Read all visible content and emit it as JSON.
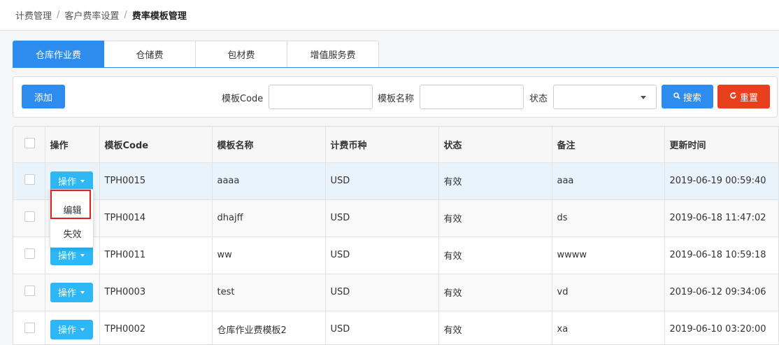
{
  "breadcrumb": [
    "计费管理",
    "客户费率设置",
    "费率模板管理"
  ],
  "tabs": [
    {
      "label": "仓库作业费",
      "active": true
    },
    {
      "label": "仓储费",
      "active": false
    },
    {
      "label": "包材费",
      "active": false
    },
    {
      "label": "增值服务费",
      "active": false
    }
  ],
  "filter": {
    "add_label": "添加",
    "code_label": "模板Code",
    "code_value": "",
    "name_label": "模板名称",
    "name_value": "",
    "status_label": "状态",
    "status_value": "",
    "search_label": "搜索",
    "reset_label": "重置"
  },
  "table": {
    "headers": [
      "操作",
      "模板Code",
      "模板名称",
      "计费币种",
      "状态",
      "备注",
      "更新时间"
    ],
    "op_label": "操作",
    "rows": [
      {
        "code": "TPH0015",
        "name": "aaaa",
        "currency": "USD",
        "status": "有效",
        "remark": "aaa",
        "updated": "2019-06-19 00:59:40"
      },
      {
        "code": "TPH0014",
        "name": "dhajff",
        "currency": "USD",
        "status": "有效",
        "remark": "ds",
        "updated": "2019-06-18 11:47:02"
      },
      {
        "code": "TPH0011",
        "name": "ww",
        "currency": "USD",
        "status": "有效",
        "remark": "wwww",
        "updated": "2019-06-18 10:59:18"
      },
      {
        "code": "TPH0003",
        "name": "test",
        "currency": "USD",
        "status": "有效",
        "remark": "vd",
        "updated": "2019-06-12 09:34:06"
      },
      {
        "code": "TPH0002",
        "name": "仓库作业费模板2",
        "currency": "USD",
        "status": "有效",
        "remark": "xa",
        "updated": "2019-06-10 03:20:00"
      }
    ]
  },
  "dropdown": {
    "edit_label": "编辑",
    "disable_label": "失效"
  },
  "colors": {
    "primary": "#2e8cee",
    "op_button": "#2db7f5",
    "reset": "#e8401c",
    "highlight_border": "#e02020"
  }
}
